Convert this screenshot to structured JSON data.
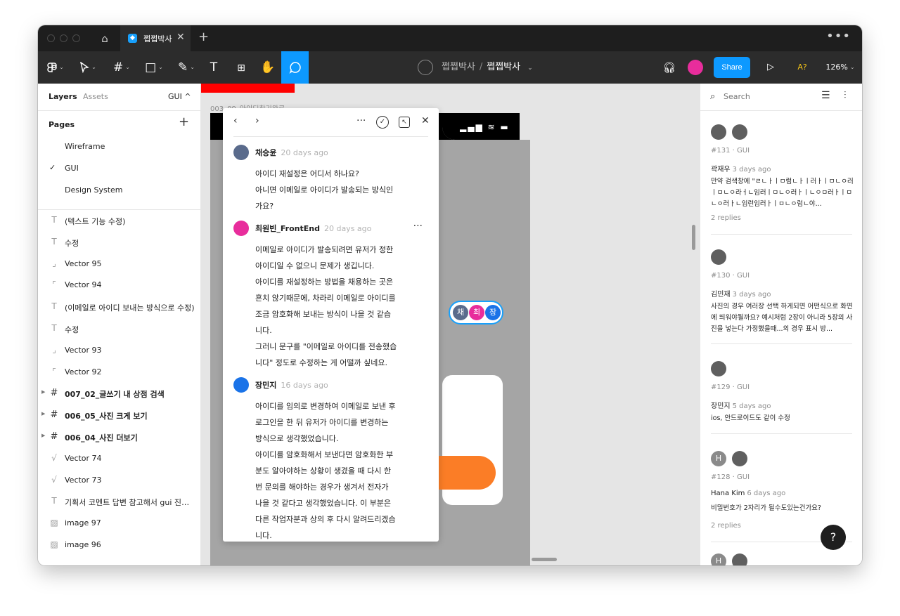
{
  "tab": {
    "title": "쩝쩝박사",
    "close": "✕",
    "new": "+",
    "more": "•••"
  },
  "toolbar": {
    "project": "쩝쩝박사",
    "separator": "/",
    "file_name": "쩝쩝박사",
    "share_label": "Share",
    "font_warning": "A?",
    "zoom": "126%"
  },
  "left_panel": {
    "tab_layers": "Layers",
    "tab_assets": "Assets",
    "page_selector": "GUI ^",
    "pages_heading": "Pages",
    "pages": [
      {
        "name": "Wireframe",
        "selected": false
      },
      {
        "name": "GUI",
        "selected": true
      },
      {
        "name": "Design System",
        "selected": false
      }
    ],
    "layers": [
      {
        "icon": "T",
        "name": "(텍스트 기능 수정)"
      },
      {
        "icon": "T",
        "name": "수정"
      },
      {
        "icon": "⌟",
        "name": "Vector 95"
      },
      {
        "icon": "⌜",
        "name": "Vector 94"
      },
      {
        "icon": "T",
        "name": "(이메일로 아이디 보내는 방식으로 수정)"
      },
      {
        "icon": "T",
        "name": "수정"
      },
      {
        "icon": "⌟",
        "name": "Vector 93"
      },
      {
        "icon": "⌜",
        "name": "Vector 92"
      },
      {
        "icon": "#",
        "name": "007_02_글쓰기 내 상점 검색"
      },
      {
        "icon": "#",
        "name": "006_05_사진 크게 보기"
      },
      {
        "icon": "#",
        "name": "006_04_사진 더보기"
      },
      {
        "icon": "√",
        "name": "Vector 74"
      },
      {
        "icon": "√",
        "name": "Vector 73"
      },
      {
        "icon": "T",
        "name": "기획서 코멘트 답변 참고해서 gui 진행할 ..."
      },
      {
        "icon": "▨",
        "name": "image 97"
      },
      {
        "icon": "▨",
        "name": "image 96"
      }
    ]
  },
  "canvas": {
    "frame_label": "003_09_아이디찾기완료",
    "modal_fragment": "다.",
    "cluster_avatars": [
      "채",
      "최",
      "장"
    ]
  },
  "thread": {
    "comments": [
      {
        "author": "채승윤",
        "time": "20 days ago",
        "lines": [
          "아이디 재설정은 어디서 하나요?",
          "아니면 이메일로 아이디가 발송되는 방식인",
          "가요?"
        ]
      },
      {
        "author": "최원빈_FrontEnd",
        "time": "20 days ago",
        "lines": [
          "이메일로 아이디가 발송되려면 유저가 정한",
          "아이디일 수 없으니 문제가 생깁니다.",
          "아이디를 재설정하는 방법을 채용하는 곳은",
          "흔치 않기때문에, 차라리 이메일로 아이디를",
          "조금 암호화해 보내는 방식이 나을 것 같습",
          "니다.",
          "그러니 문구를 \"이메일로 아이디를 전송했습",
          "니다\" 정도로 수정하는 게 어떨까 싶네요."
        ]
      },
      {
        "author": "장민지",
        "time": "16 days ago",
        "lines": [
          "아이디를 임의로 변경하여 이메일로 보낸 후",
          "로그인을 한 뒤 유저가 아이디를 변경하는",
          "방식으로 생각했었습니다.",
          "아이디를 암호화해서 보낸다면 암호화한 부",
          "분도 알아야하는 상황이 생겼을 때 다시 한",
          "번 문의를 해야하는 경우가 생겨서 전자가",
          "나을 것 같다고 생각했었습니다. 이 부분은",
          "다른 작업자분과 상의 후 다시 알려드리겠습",
          "니다."
        ]
      }
    ]
  },
  "right_panel": {
    "search_placeholder": "Search",
    "cards": [
      {
        "avatars": [
          "",
          ""
        ],
        "meta": "#131 · GUI",
        "author": "곽재우",
        "time": "3 days ago",
        "text": "만약 검색창에 \"ㄹㄴㅏㅣㅁ럼ㄴㅏㅣ러ㅏㅣㅁㄴㅇ러ㅣㅁㄴㅇ라ㅓㄴ임러ㅣㅁㄴㅇ러ㅏㅣㄴㅇㅁ러ㅏㅣㅁㄴㅇ러ㅏㄴ임런임러ㅏㅣㅁㄴㅇ럼ㄴ야...",
        "replies": "2 replies"
      },
      {
        "avatars": [
          ""
        ],
        "meta": "#130 · GUI",
        "author": "김민재",
        "time": "3 days ago",
        "text": "사진의 경우 여러장 선택 하게되면 어떤식으로 화면에 띄워야될까요? 예시처럼 2장이 아니라 5장의 사진을 넣는다 가정했을때...의 경우 표시 방...",
        "replies": ""
      },
      {
        "avatars": [
          ""
        ],
        "meta": "#129 · GUI",
        "author": "장민지",
        "time": "5 days ago",
        "text": "ios, 안드로이드도 같이 수정",
        "replies": ""
      },
      {
        "avatars": [
          "H",
          ""
        ],
        "meta": "#128 · GUI",
        "author": "Hana Kim",
        "time": "6 days ago",
        "text": "비밀번호가 2자리가 될수도있는건가요?",
        "replies": "2 replies"
      },
      {
        "avatars": [
          "H",
          ""
        ],
        "meta": "",
        "author": "",
        "time": "",
        "text": "",
        "replies": ""
      }
    ],
    "help": "?"
  },
  "colors": {
    "accent": "#0d99ff",
    "toolbar_bg": "#2c2c2c",
    "orange_button": "#fb7d26",
    "avatar_pink": "#e82d9c",
    "avatar_blue": "#1a73e8",
    "avatar_slate": "#5a6b8c"
  }
}
